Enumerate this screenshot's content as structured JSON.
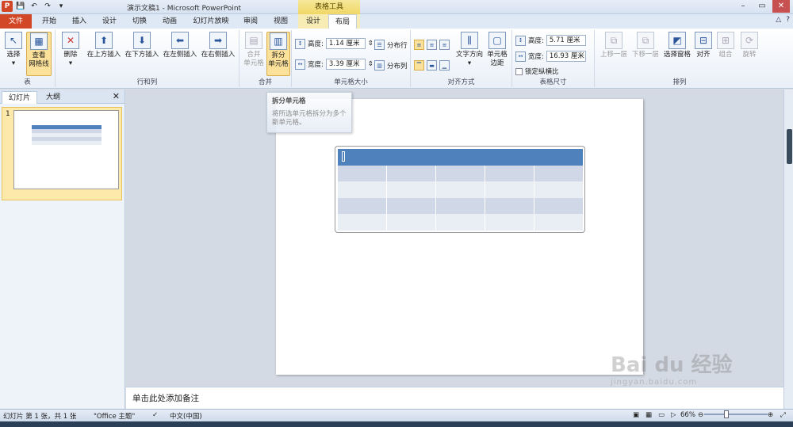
{
  "window": {
    "title": "演示文稿1 - Microsoft PowerPoint",
    "context_tab_group": "表格工具"
  },
  "qat": {
    "app_icon": "P",
    "save_icon": "save-icon",
    "undo_icon": "undo-icon",
    "redo_icon": "redo-icon"
  },
  "tabs": [
    "文件",
    "开始",
    "插入",
    "设计",
    "切换",
    "动画",
    "幻灯片放映",
    "审阅",
    "视图",
    "设计",
    "布局"
  ],
  "ribbon": {
    "groups": {
      "table": "表",
      "rows_cols": "行和列",
      "merge": "合并",
      "cell_size": "单元格大小",
      "alignment": "对齐方式",
      "table_size": "表格尺寸",
      "arrange": "排列"
    },
    "buttons": {
      "select": "选择",
      "gridlines_1": "查看",
      "gridlines_2": "网格线",
      "delete": "删除",
      "insert_above": "在上方插入",
      "insert_below": "在下方插入",
      "insert_left": "在左侧插入",
      "insert_right": "在右侧插入",
      "merge_1": "合并",
      "merge_2": "单元格",
      "split_1": "拆分",
      "split_2": "单元格",
      "text_direction": "文字方向",
      "cell_margins_1": "单元格",
      "cell_margins_2": "边距",
      "bring_forward": "上移一层",
      "send_backward": "下移一层",
      "selection_pane": "选择窗格",
      "align": "对齐",
      "group": "组合",
      "rotate": "旋转"
    },
    "cell_size": {
      "height_label": "高度:",
      "height_value": "1.14 厘米",
      "width_label": "宽度:",
      "width_value": "3.39 厘米",
      "distribute_rows": "分布行",
      "distribute_cols": "分布列"
    },
    "table_size": {
      "height_label": "高度:",
      "height_value": "5.71 厘米",
      "width_label": "宽度:",
      "width_value": "16.93 厘米",
      "lock_ratio": "锁定纵横比"
    }
  },
  "tooltip": {
    "title": "拆分单元格",
    "body": "将所选单元格拆分为多个新单元格。"
  },
  "pane": {
    "tab_slides": "幻灯片",
    "tab_outline": "大纲",
    "close": "✕",
    "slide_number": "1"
  },
  "slide": {
    "table_rows": 5,
    "table_cols": 5
  },
  "notes": {
    "placeholder": "单击此处添加备注"
  },
  "status": {
    "slide_info": "幻灯片 第 1 张，共 1 张",
    "theme": "\"Office 主题\"",
    "language": "中文(中国)",
    "zoom": "66%"
  },
  "watermark": {
    "brand": "Bai du 经验",
    "url": "jingyan.baidu.com"
  },
  "badge": "66"
}
